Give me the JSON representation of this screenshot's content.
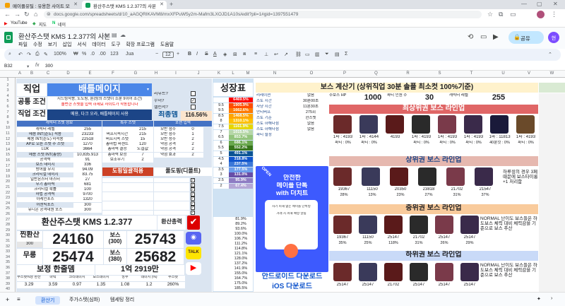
{
  "browser": {
    "tabs": [
      {
        "label": "메이플유틸 : 유용한 사이트 모",
        "active": false
      },
      {
        "label": "환산주스탯 KMS 1.2.377의 사본",
        "active": true
      }
    ],
    "url": "docs.google.com/spreadsheets/d/10_aAGQRIKAVM8/mxXFPuW5y2m-Mafm3LXOJD1A10s/edit?pli=1#gid=1397551479",
    "bookmarks": [
      "YouTube",
      "지도",
      "네이"
    ]
  },
  "sheets": {
    "doc_title": "환산주스탯 KMS 1.2.377의 사본",
    "menu": [
      "파일",
      "수정",
      "보기",
      "삽입",
      "서식",
      "데이터",
      "도구",
      "확장 프로그램",
      "도움말"
    ],
    "share_label": "공유",
    "avatar_letter": "현",
    "zoom": "100%",
    "font_name": "Jua",
    "font_size": "12",
    "cell_ref": "B32",
    "formula": "300",
    "columns": [
      "A",
      "B",
      "C",
      "D",
      "E",
      "F",
      "G",
      "H",
      "I",
      "J",
      "K",
      "L",
      "M",
      "N",
      "O",
      "P",
      "Q",
      "R",
      "S",
      "T",
      "U",
      "V",
      "W"
    ],
    "sheet_tabs": [
      "환산기",
      "주가스텟(심화)",
      "템세팅 정리"
    ]
  },
  "left": {
    "job_label": "직업",
    "job_value": "배틀메이지",
    "common_label": "공통 조건",
    "common_text1": "시드링작용, 노도핑, 룬(링의 스탯이 소분 9이어 조건)",
    "common_text2": "솔번한 스텟을 입력 하세요 사이트가 작동합니다",
    "job_cond_label": "직업 조건",
    "job_cond_text": "메용, 다크 오라, 배틀메이지 사용",
    "reboot_label": "리부트?",
    "mune_label": "무이?",
    "challenger_label": "챌린저?",
    "final_label": "최종뎀",
    "final_value": "116.56%",
    "stats_header": "캐릭터 스텟 정보",
    "special_header": "특수 스텟",
    "stats": [
      {
        "name": "캐릭터 레벨",
        "value": "255"
      },
      {
        "name": "메용 INT(순도) 적용",
        "value": "23233"
      },
      {
        "name": "메용 INT(순도) 미적용",
        "value": "22518"
      },
      {
        "name": "AP로 오른 스텟 주 스텟",
        "value": "1270"
      },
      {
        "name": "LUK",
        "value": "3664"
      },
      {
        "name": "메용 스텟 INT(총량)",
        "value": "10,835.913"
      },
      {
        "name": "공격력",
        "value": "91"
      },
      {
        "name": "보스 데미지",
        "value": "336"
      },
      {
        "name": "방어율 무시",
        "value": "94.09"
      },
      {
        "name": "크리티컬 데미지",
        "value": "83.75"
      },
      {
        "name": "일반몬스터 마스터",
        "value": "27"
      },
      {
        "name": "무기 총마력",
        "value": "681"
      },
      {
        "name": "크리티컬 확률",
        "value": "100"
      },
      {
        "name": "마법 공격력",
        "value": "9700"
      },
      {
        "name": "아케인포스",
        "value": "1320"
      },
      {
        "name": "어센틱포스",
        "value": "300"
      },
      {
        "name": "유니온 공격대원 포스",
        "value": "300"
      }
    ],
    "special": [
      {
        "name": "",
        "value": "215"
      },
      {
        "name": "버프지속시간",
        "value": "215"
      },
      {
        "name": "버프지속 스탯",
        "value": "15"
      },
      {
        "name": "총마법 퍼센트",
        "value": "120"
      },
      {
        "name": "총마력 결정",
        "value": "노결값"
      },
      {
        "name": "총마력 보정",
        "value": "7"
      },
      {
        "name": "보조무기",
        "value": "2"
      }
    ],
    "potion_header": "포션 입력",
    "potions": [
      {
        "name": "모반 점수",
        "value": "0"
      },
      {
        "name": "모반 점수",
        "value": "1"
      },
      {
        "name": "모반 성수",
        "value": "2"
      },
      {
        "name": "약점 공격",
        "value": "2"
      },
      {
        "name": "약점 공격",
        "value": "2"
      },
      {
        "name": "약점 효과",
        "value": "2"
      }
    ],
    "doping_label": "도핑일괄적용",
    "doping_right": "풀도핑(디폴트)",
    "banner": "환산주스탯 KMS 1.2.377",
    "hwansan_label": "환산총력",
    "jinhwansan_label": "찐환산",
    "jinhwansan_value": "24160",
    "muryo_label": "무릉",
    "muryo_value": "25474",
    "boss300_label": "보스 (300)",
    "boss300_value": "25743",
    "boss380_label": "보스 (380)",
    "boss380_value": "25682",
    "bojeong_label": "보정 한줄뎀",
    "bojeong_value": "1억 2919만",
    "bottom_headers": [
      "주스텟%당 환산",
      "마력",
      "크리데미지",
      "보스데미지",
      "방무",
      "데미지 (%)",
      "주스텟"
    ],
    "bottom_values": [
      "3.29",
      "3.59",
      "0.97",
      "1.35",
      "1.08",
      "1.2",
      "260%"
    ],
    "input_value": "300"
  },
  "growth": {
    "title": "성장표",
    "rows": [
      {
        "a": "",
        "b": "6469.5%"
      },
      {
        "a": "9.5",
        "b": "1905.9%"
      },
      {
        "a": "9.5",
        "b": "1662.6%"
      },
      {
        "a": "8.5",
        "b": "1468.5%"
      },
      {
        "a": "8",
        "b": "1310.1%"
      },
      {
        "a": "7.5",
        "b": "1161.9%"
      },
      {
        "a": "7",
        "b": "1015.5%"
      },
      {
        "a": "6.5",
        "b": "853.7%"
      },
      {
        "a": "6",
        "b": "686.1%"
      },
      {
        "a": "5.5",
        "b": "552.2%"
      },
      {
        "a": "5",
        "b": "491.1%"
      },
      {
        "a": "4.5",
        "b": "318.8%"
      },
      {
        "a": "4",
        "b": "237.5%"
      },
      {
        "a": "3.5",
        "b": "177.5%"
      },
      {
        "a": "3",
        "b": "131.0%"
      },
      {
        "a": "2.5",
        "b": "95.9%"
      },
      {
        "a": "2",
        "b": "67.4%"
      }
    ],
    "lower_rows": [
      "81.9%",
      "89.2%",
      "93.6%",
      "100.0%",
      "106.7%",
      "111.2%",
      "114.8%",
      "121.1%",
      "128.0%",
      "137.2%",
      "141.9%",
      "155.0%",
      "164.7%",
      "175.0%",
      "185.5%"
    ]
  },
  "boss": {
    "title": "보스 계산기 (상위직업 30분 솔플 최소컷 100%기준)",
    "info_rows": [
      {
        "k": "리레이션",
        "v": "없음"
      },
      {
        "k": "스토 시간",
        "v": "30분00초"
      },
      {
        "k": "사냥 시간",
        "v": "11분30초"
      },
      {
        "k": "안티버프",
        "v": "275회"
      },
      {
        "k": "스토 기준",
        "v": "현스텟"
      },
      {
        "k": "스토 하해다점",
        "v": "없음"
      },
      {
        "k": "스토 하해다점",
        "v": "없음"
      },
      {
        "k": "파티 설정",
        "v": ""
      }
    ],
    "hp_label": "주보스 HP",
    "hp_value": "1000",
    "mid_label": "파티 인원 수",
    "mid_value": "30",
    "lv_label": "캐릭터 레벨",
    "lv_value": "255",
    "top_title": "최상위권 보스 라인업",
    "top_values": [
      "1파 : 4193",
      "1파 : 4144",
      "4193",
      "1파 : 4193",
      "1파 : 4193",
      "1파 : 4193",
      "1파 : 11813",
      "1파 : 4193"
    ],
    "top_pct": [
      "파티 : 0%",
      "파티 : 0%",
      "",
      "파티 : 0%",
      "파티 : 0%",
      "파티 : 0%",
      "40분컷 : 0%",
      "파티 : 0%"
    ],
    "high_title": "상위권 보스 라인업",
    "high_values": [
      "19367",
      "11150",
      "20350",
      "23818",
      "21702",
      "21547"
    ],
    "high_pct": [
      "28%",
      "13%",
      "23%",
      "27%",
      "31%",
      "37%"
    ],
    "high_note": "하루윙의 경우 3페 때문에 보스타이롱 +1 처리함",
    "mid_title": "중위권 보스 라인업",
    "mid_values": [
      "19367",
      "11150",
      "25147",
      "21702",
      "25147",
      "25147"
    ],
    "mid_pct": [
      "35%",
      "25%",
      "118%",
      "31%",
      "26%",
      "29%"
    ],
    "mid_note": "NORMAL 난이도 보스들은 하도보스 체력 대비 체력감을 기준으로 보스 추산",
    "low_title": "하위권 보스 라인업",
    "low_values": [
      "25147",
      "25147",
      "21702",
      "25147",
      "25147",
      "25147"
    ],
    "low_note": "NORMAL 난이도 보스들은 하도보스 체력 대비 체력감을 기준으로 보스 추산",
    "open_label": "OPEN",
    "ad_title1": "안전한",
    "ad_title2": "메이플 단톡",
    "ad_title3": "with 더치트",
    "ad_line1": "사기 피해 없는 메이플 단톡방",
    "ad_line2": "거래 시 피해 예방 알림",
    "android_label": "안드로이드 다운로드",
    "ios_label": "iOS 다운로드"
  }
}
